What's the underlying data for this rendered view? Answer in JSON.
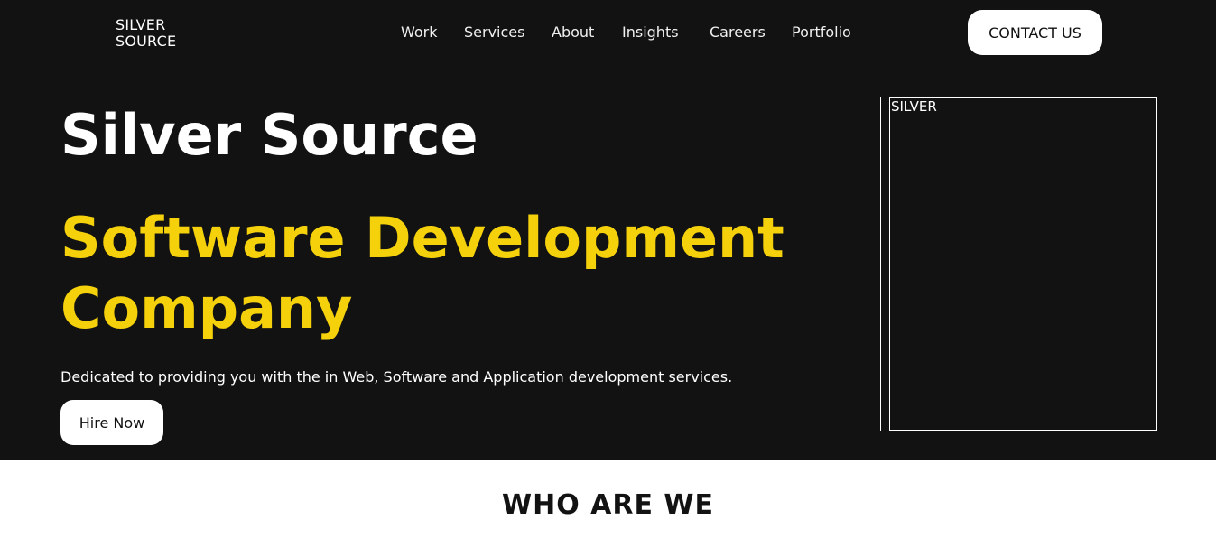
{
  "header": {
    "logo_line1": "SILVER",
    "logo_line2": "SOURCE",
    "nav": [
      "Work",
      "Services",
      "About",
      "Insights",
      "Careers",
      "Portfolio"
    ],
    "contact_label": "CONTACT US"
  },
  "hero": {
    "title": "Silver Source",
    "subtitle_line1": "Software Development",
    "subtitle_line2": "Company",
    "description": "Dedicated to providing you with the in Web, Software and Application development services.",
    "cta_label": "Hire Now",
    "media_label": "SILVER"
  },
  "section": {
    "title": "WHO ARE WE"
  },
  "colors": {
    "background_dark": "#121212",
    "accent_yellow": "#f5d10c",
    "white": "#ffffff"
  }
}
